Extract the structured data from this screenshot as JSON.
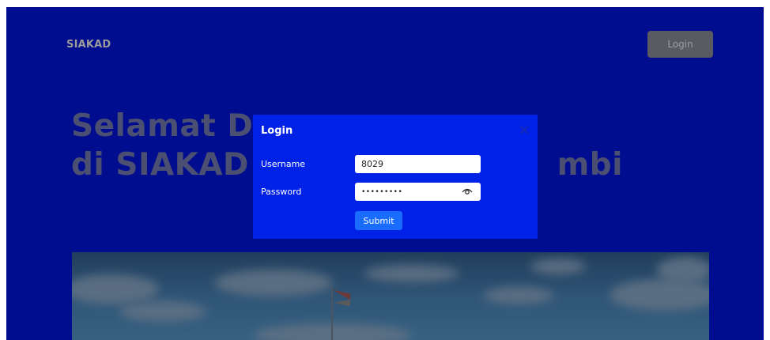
{
  "navbar": {
    "brand": "SIAKAD",
    "login_label": "Login"
  },
  "hero": {
    "line1": "Selamat D",
    "line2": "di SIAKAD S",
    "line2_tail": "mbi"
  },
  "modal": {
    "title": "Login",
    "close_icon": "close-icon",
    "username": {
      "label": "Username",
      "value": "8029"
    },
    "password": {
      "label": "Password",
      "value": "•••••••••",
      "toggle_icon": "eye-icon"
    },
    "submit_label": "Submit"
  },
  "colors": {
    "page_bg": "#000d8f",
    "modal_bg": "#0021e6",
    "submit_bg": "#1a6cff",
    "nav_button_bg": "#5a5a62"
  }
}
